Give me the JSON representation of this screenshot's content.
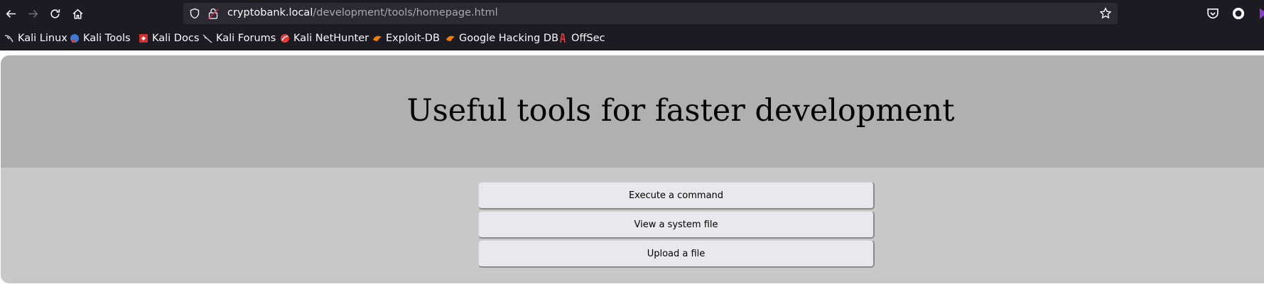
{
  "browser": {
    "url_host": "cryptobank.local",
    "url_path": "/development/tools/homepage.html"
  },
  "bookmarks": [
    {
      "label": "Kali Linux",
      "icon": "kali-dragon-icon"
    },
    {
      "label": "Kali Tools",
      "icon": "kali-tools-icon"
    },
    {
      "label": "Kali Docs",
      "icon": "kali-docs-icon"
    },
    {
      "label": "Kali Forums",
      "icon": "kali-forums-icon"
    },
    {
      "label": "Kali NetHunter",
      "icon": "kali-nethunter-icon"
    },
    {
      "label": "Exploit-DB",
      "icon": "exploit-db-icon"
    },
    {
      "label": "Google Hacking DB",
      "icon": "ghdb-icon"
    },
    {
      "label": "OffSec",
      "icon": "offsec-icon"
    }
  ],
  "page": {
    "title": "Useful tools for faster development",
    "buttons": [
      {
        "label": "Execute a command"
      },
      {
        "label": "View a system file"
      },
      {
        "label": "Upload a file"
      }
    ]
  },
  "colors": {
    "chrome_bg": "#1c1b22",
    "urlbar_bg": "#2b2a33",
    "header_bg": "#b0b0b0",
    "body_bg": "#c8c8c8",
    "button_bg": "#e9e9ed"
  }
}
